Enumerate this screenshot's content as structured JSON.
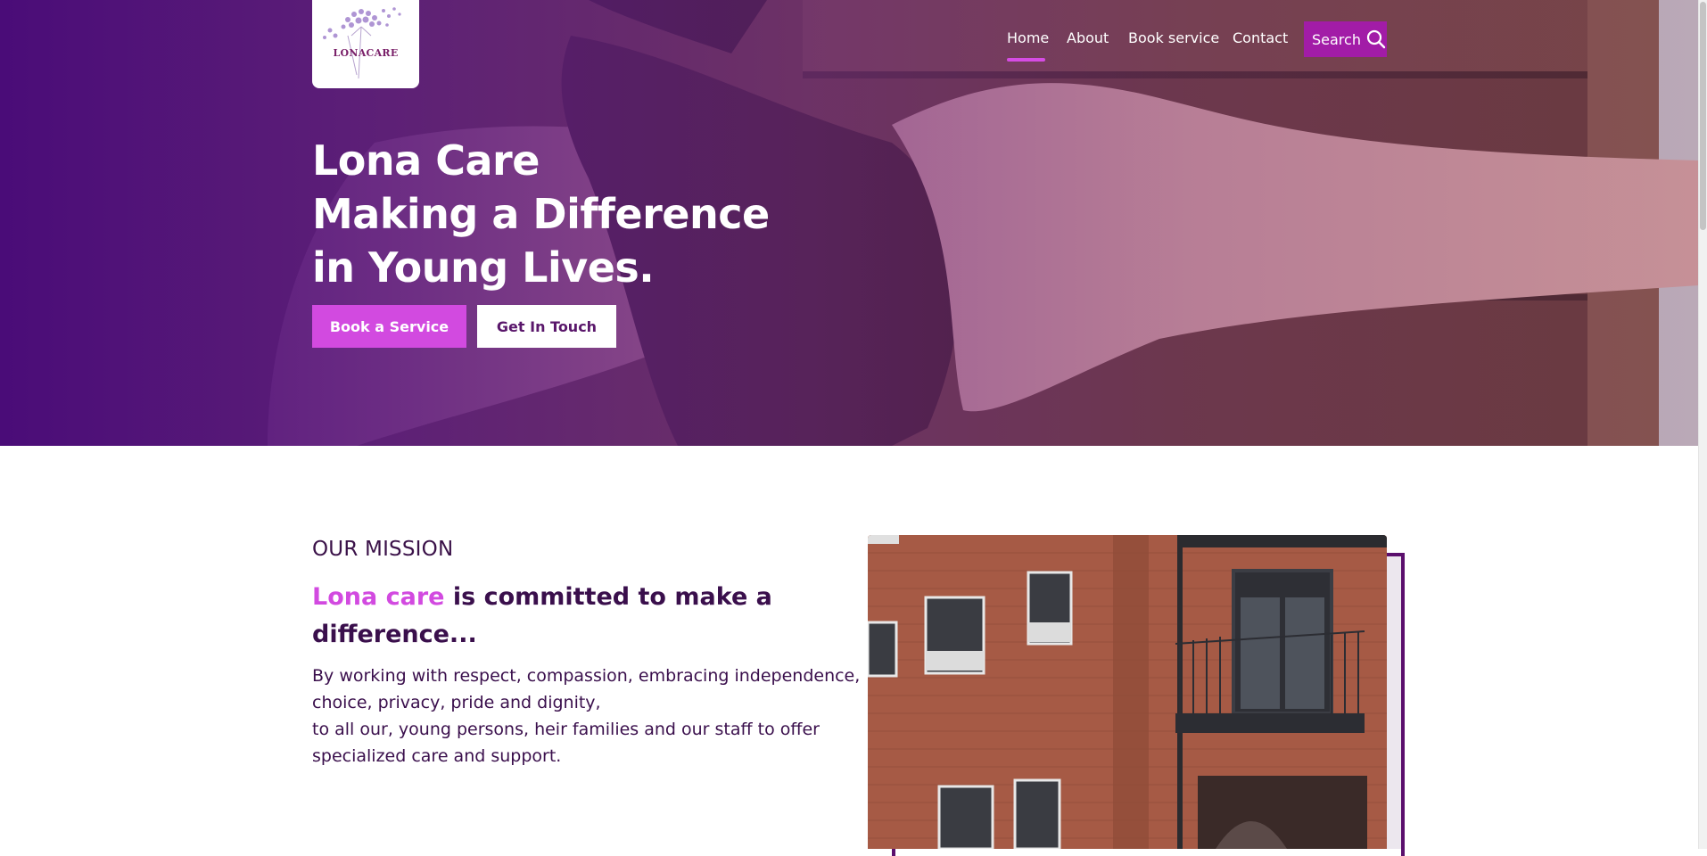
{
  "logo": {
    "text": "LONACARE"
  },
  "nav": {
    "items": [
      "Home",
      "About",
      "Book service",
      "Contact"
    ],
    "active": "Home",
    "search_label": "Search"
  },
  "hero": {
    "title_lines": [
      "Lona Care",
      "Making a Difference",
      "in Young Lives."
    ],
    "primary_button": "Book a Service",
    "secondary_button": "Get In Touch"
  },
  "mission": {
    "eyebrow": "OUR MISSION",
    "heading_accent": "Lona care",
    "heading_rest_line1": " is committed to make a",
    "heading_rest_line2": "difference...",
    "body_lines": [
      "By working with respect, compassion, embracing independence,",
      "choice, privacy, pride and dignity,",
      "to all our, young persons, heir families and our staff to offer",
      "specialized care and support."
    ]
  },
  "colors": {
    "brand_purple": "#4a0c78",
    "accent_pink": "#d24ae0",
    "search_bg": "#a21ca7",
    "heading_dark": "#3a0f4c",
    "frame_purple": "#5b0f6d"
  },
  "icons": {
    "search": "magnifier-icon",
    "logo_flower": "dandelion-flower-icon"
  }
}
